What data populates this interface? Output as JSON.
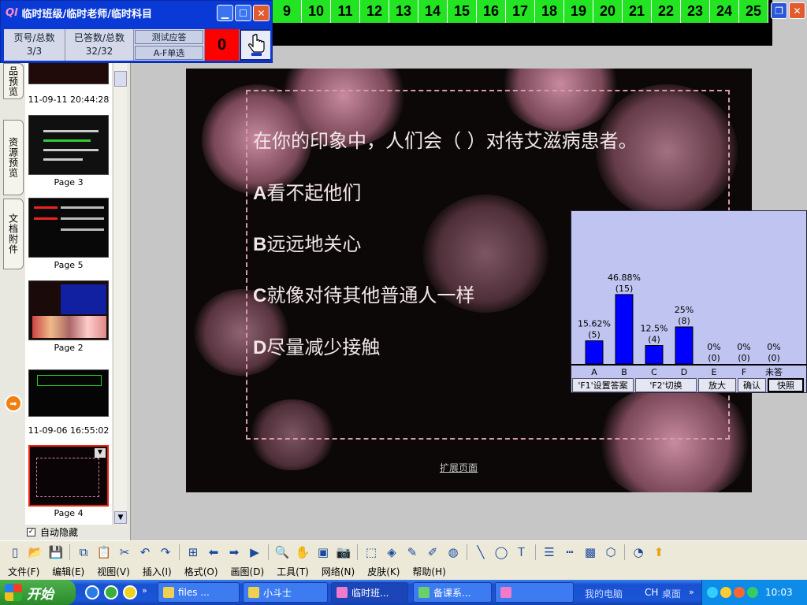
{
  "numbers": [
    "9",
    "10",
    "11",
    "12",
    "13",
    "14",
    "15",
    "16",
    "17",
    "18",
    "19",
    "20",
    "21",
    "22",
    "23",
    "24",
    "25"
  ],
  "panel": {
    "title": "临时班级/临时老师/临时科目",
    "logo": "Ql",
    "page_label": "页号/总数",
    "page_value": "3/3",
    "answered_label": "已答数/总数",
    "answered_value": "32/32",
    "test_button": "测试应答",
    "mode_button": "A-F单选",
    "counter": "0"
  },
  "sidebar": {
    "tabs": [
      "品预览",
      "资源预览",
      "文档附件"
    ],
    "thumbs": [
      {
        "label": "11-09-11 20:44:28"
      },
      {
        "label": "Page 3"
      },
      {
        "label": "Page 5"
      },
      {
        "label": "Page 2"
      },
      {
        "label": "11-09-06 16:55:02"
      },
      {
        "label": "Page 4"
      }
    ],
    "autohide": "自动隐藏"
  },
  "slide": {
    "question": "在你的印象中，人们会（      ）对待艾滋病患者。",
    "options": [
      {
        "letter": "A",
        "text": "看不起他们"
      },
      {
        "letter": "B",
        "text": "远远地关心"
      },
      {
        "letter": "C",
        "text": "就像对待其他普通人一样"
      },
      {
        "letter": "D",
        "text": "尽量减少接触"
      }
    ],
    "expand_link": "扩展页面"
  },
  "chart_data": {
    "type": "bar",
    "categories": [
      "A",
      "B",
      "C",
      "D",
      "E",
      "F",
      "未答"
    ],
    "values": [
      15.62,
      46.88,
      12.5,
      25,
      0,
      0,
      0
    ],
    "counts": [
      5,
      15,
      4,
      8,
      0,
      0,
      0
    ],
    "pct_labels": [
      "15.62%",
      "46.88%",
      "12.5%",
      "25%",
      "0%",
      "0%",
      "0%"
    ],
    "count_labels": [
      "(5)",
      "(15)",
      "(4)",
      "(8)",
      "(0)",
      "(0)",
      "(0)"
    ],
    "ylim": [
      0,
      50
    ],
    "bar_color": "#0000ff",
    "background": "#c0c4f0"
  },
  "chart_buttons": [
    "'F1'设置答案",
    "'F2'切换",
    "放大",
    "确认",
    "快照"
  ],
  "menubar": [
    "文件(F)",
    "编辑(E)",
    "视图(V)",
    "插入(I)",
    "格式(O)",
    "画图(D)",
    "工具(T)",
    "网络(N)",
    "皮肤(K)",
    "帮助(H)"
  ],
  "taskbar": {
    "start": "开始",
    "tasks": [
      "files ...",
      "小斗士",
      "临时班...",
      "备课系...",
      ""
    ],
    "links": [
      "我的电脑",
      "CH",
      "桌面"
    ],
    "clock": "10:03"
  }
}
